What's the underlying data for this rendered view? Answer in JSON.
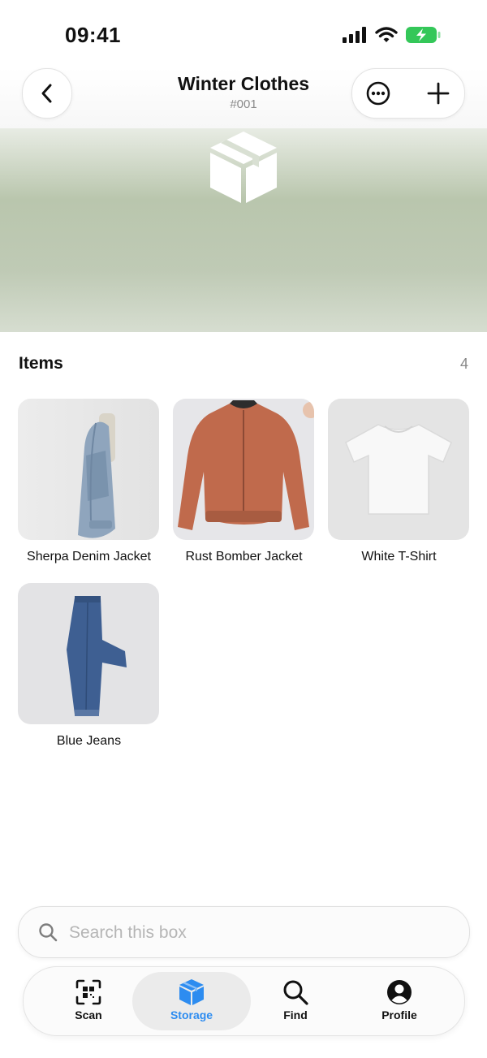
{
  "status_bar": {
    "time": "09:41"
  },
  "header": {
    "title": "Winter Clothes",
    "subtitle": "#001"
  },
  "items_section": {
    "title": "Items",
    "count": "4"
  },
  "items": [
    {
      "label": "Sherpa Denim Jacket"
    },
    {
      "label": "Rust Bomber Jacket"
    },
    {
      "label": "White T-Shirt"
    },
    {
      "label": "Blue Jeans"
    }
  ],
  "search": {
    "placeholder": "Search this box"
  },
  "tabs": [
    {
      "label": "Scan",
      "icon": "qr-scan-icon"
    },
    {
      "label": "Storage",
      "icon": "box-icon",
      "active": true
    },
    {
      "label": "Find",
      "icon": "search-icon"
    },
    {
      "label": "Profile",
      "icon": "profile-icon"
    }
  ],
  "colors": {
    "accent": "#2d8cf0",
    "banner": "#b9c6ad",
    "battery": "#34c759"
  }
}
